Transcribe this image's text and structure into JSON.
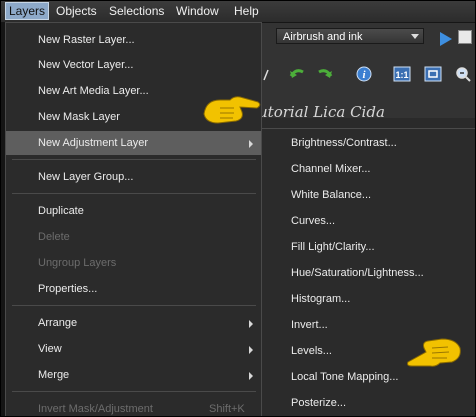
{
  "menubar": {
    "items": [
      {
        "label": "Layers",
        "active": true
      },
      {
        "label": "Objects",
        "active": false
      },
      {
        "label": "Selections",
        "active": false
      },
      {
        "label": "Window",
        "active": false
      },
      {
        "label": "Help",
        "active": false
      }
    ]
  },
  "toolbar": {
    "preset_value": "Airbrush and ink",
    "icons": [
      "play-icon",
      "rotate-left-icon",
      "rotate-right-icon",
      "info-icon",
      "actual-size-icon",
      "fit-window-icon",
      "zoom-icon"
    ]
  },
  "watermark": "Tutorial Lica Cida",
  "layers_menu": {
    "items": [
      {
        "label": "New Raster Layer...",
        "enabled": true
      },
      {
        "label": "New Vector Layer...",
        "enabled": true
      },
      {
        "label": "New Art Media Layer...",
        "enabled": true
      },
      {
        "label": "New Mask Layer",
        "enabled": true
      },
      {
        "label": "New Adjustment Layer",
        "enabled": true,
        "submenu": true,
        "highlighted": true
      },
      {
        "label": "New Layer Group...",
        "enabled": true
      },
      {
        "label": "Duplicate",
        "enabled": true
      },
      {
        "label": "Delete",
        "enabled": false
      },
      {
        "label": "Ungroup Layers",
        "enabled": false
      },
      {
        "label": "Properties...",
        "enabled": true
      },
      {
        "label": "Arrange",
        "enabled": true,
        "submenu": true
      },
      {
        "label": "View",
        "enabled": true,
        "submenu": true
      },
      {
        "label": "Merge",
        "enabled": true,
        "submenu": true
      },
      {
        "label": "Invert Mask/Adjustment",
        "enabled": false,
        "shortcut": "Shift+K"
      }
    ]
  },
  "adjustment_submenu": {
    "items": [
      "Brightness/Contrast...",
      "Channel Mixer...",
      "White Balance...",
      "Curves...",
      "Fill Light/Clarity...",
      "Hue/Saturation/Lightness...",
      "Histogram...",
      "Invert...",
      "Levels...",
      "Local Tone Mapping...",
      "Posterize..."
    ]
  },
  "colors": {
    "menubar_active": "#8da9c9",
    "menu_bg": "#2b2b2b",
    "highlight": "#5e5e5e",
    "disabled_text": "#6c6c6c",
    "play_blue": "#3e8fe0",
    "pointer_hand": "#f2c200"
  }
}
